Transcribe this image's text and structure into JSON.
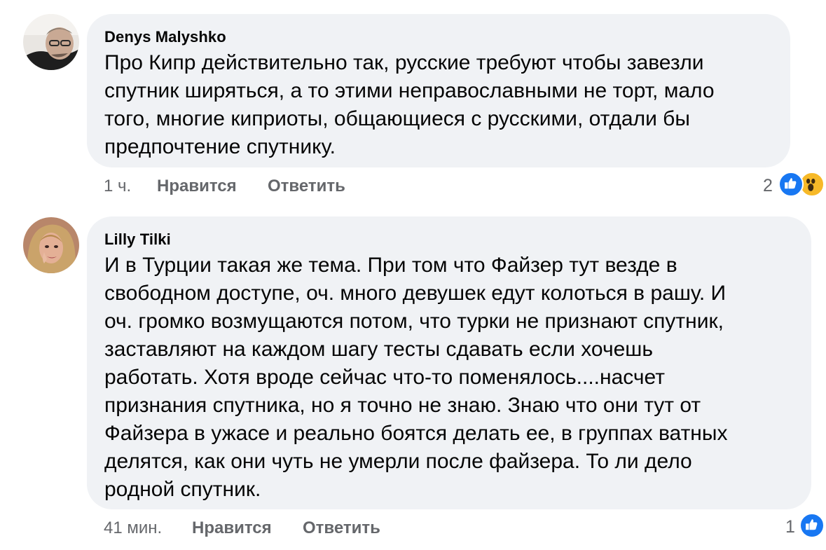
{
  "comments": [
    {
      "author": "Denys Malyshko",
      "text": "Про Кипр действительно так, русские требуют чтобы завезли\nспутник ширяться, а то этими неправославными не торт, мало\nтого, многие киприоты, общающиеся с русскими, отдали бы\nпредпочтение спутнику.",
      "time": "1 ч.",
      "like_label": "Нравится",
      "reply_label": "Ответить",
      "reaction_count": "2",
      "reactions": [
        "like-icon",
        "wow-icon"
      ]
    },
    {
      "author": "Lilly Tilki",
      "text": "И в Турции такая же тема. При том что Файзер тут везде в\nсвободном доступе, оч. много девушек едут колоться в рашу. И\nоч. громко возмущаются потом, что турки не признают спутник,\nзаставляют на каждом шагу тесты сдавать если хочешь\nработать. Хотя вроде сейчас что-то поменялось....насчет\nпризнания спутника, но я точно не знаю. Знаю что они тут от\nФайзера в ужасе и реально боятся делать ее, в группах ватных\nделятся, как они чуть не умерли после файзера. То ли дело\nродной спутник.",
      "time": "41 мин.",
      "like_label": "Нравится",
      "reply_label": "Ответить",
      "reaction_count": "1",
      "reactions": [
        "like-icon"
      ]
    }
  ],
  "colors": {
    "bubble": "#f0f2f5",
    "meta_text": "#65676b",
    "like_blue": "#1877f2",
    "wow_yellow": "#f7b928"
  }
}
